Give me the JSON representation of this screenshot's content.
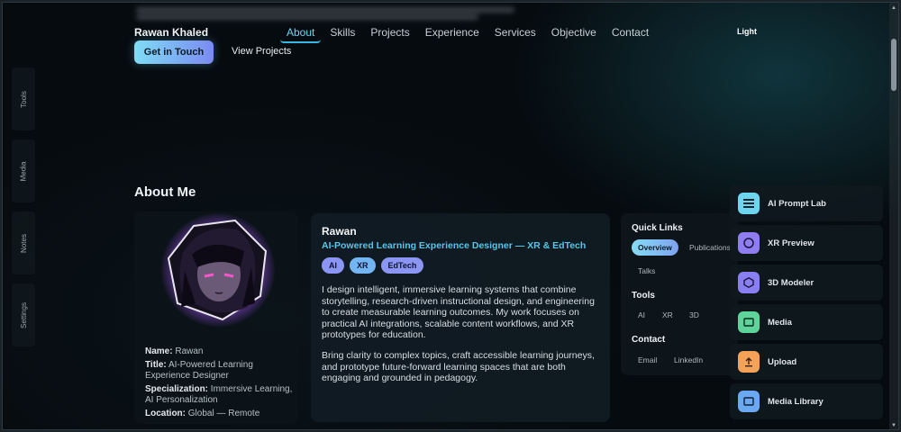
{
  "header": {
    "brand": "Rawan Khaled",
    "nav": [
      "About",
      "Skills",
      "Projects",
      "Experience",
      "Services",
      "Objective",
      "Contact"
    ],
    "active_nav": "About",
    "theme_toggle": "Light",
    "cta_primary": "Get in Touch",
    "cta_secondary": "View Projects"
  },
  "side_rail": [
    "Tools",
    "Media",
    "Notes",
    "Settings"
  ],
  "about": {
    "section_title": "About Me",
    "profile": {
      "name_label": "Name:",
      "name_value": "Rawan",
      "title_label": "Title:",
      "title_value": "AI-Powered Learning Experience Designer",
      "spec_label": "Specialization:",
      "spec_value": "Immersive Learning, AI Personalization",
      "loc_label": "Location:",
      "loc_value": "Global — Remote"
    },
    "card": {
      "name": "Rawan",
      "role": "AI-Powered Learning Experience Designer — XR & EdTech",
      "chips": [
        "AI",
        "XR",
        "EdTech"
      ],
      "p1": "I design intelligent, immersive learning systems that combine storytelling, research-driven instructional design, and engineering to create measurable learning outcomes. My work focuses on practical AI integrations, scalable content workflows, and XR prototypes for education.",
      "p2": "Bring clarity to complex topics, craft accessible learning journeys, and prototype future-forward learning spaces that are both engaging and grounded in pedagogy."
    }
  },
  "quick_links": {
    "title": "Quick Links",
    "links": [
      "Overview",
      "Publications",
      "Talks"
    ],
    "tools_title": "Tools",
    "tools": [
      "AI",
      "XR",
      "3D"
    ],
    "contact_title": "Contact",
    "contact": [
      "Email",
      "LinkedIn"
    ]
  },
  "dock": [
    {
      "label": "AI Prompt Lab",
      "icon": "list-icon",
      "color": "#6fd4f0"
    },
    {
      "label": "XR Preview",
      "icon": "circle-icon",
      "color": "#8f7df2"
    },
    {
      "label": "3D Modeler",
      "icon": "hexagon-icon",
      "color": "#8a7ff0"
    },
    {
      "label": "Media",
      "icon": "rectangle-icon",
      "color": "#5fd49a"
    },
    {
      "label": "Upload",
      "icon": "upload-icon",
      "color": "#f3a25a"
    },
    {
      "label": "Media Library",
      "icon": "square-icon",
      "color": "#6aa8f2"
    }
  ]
}
